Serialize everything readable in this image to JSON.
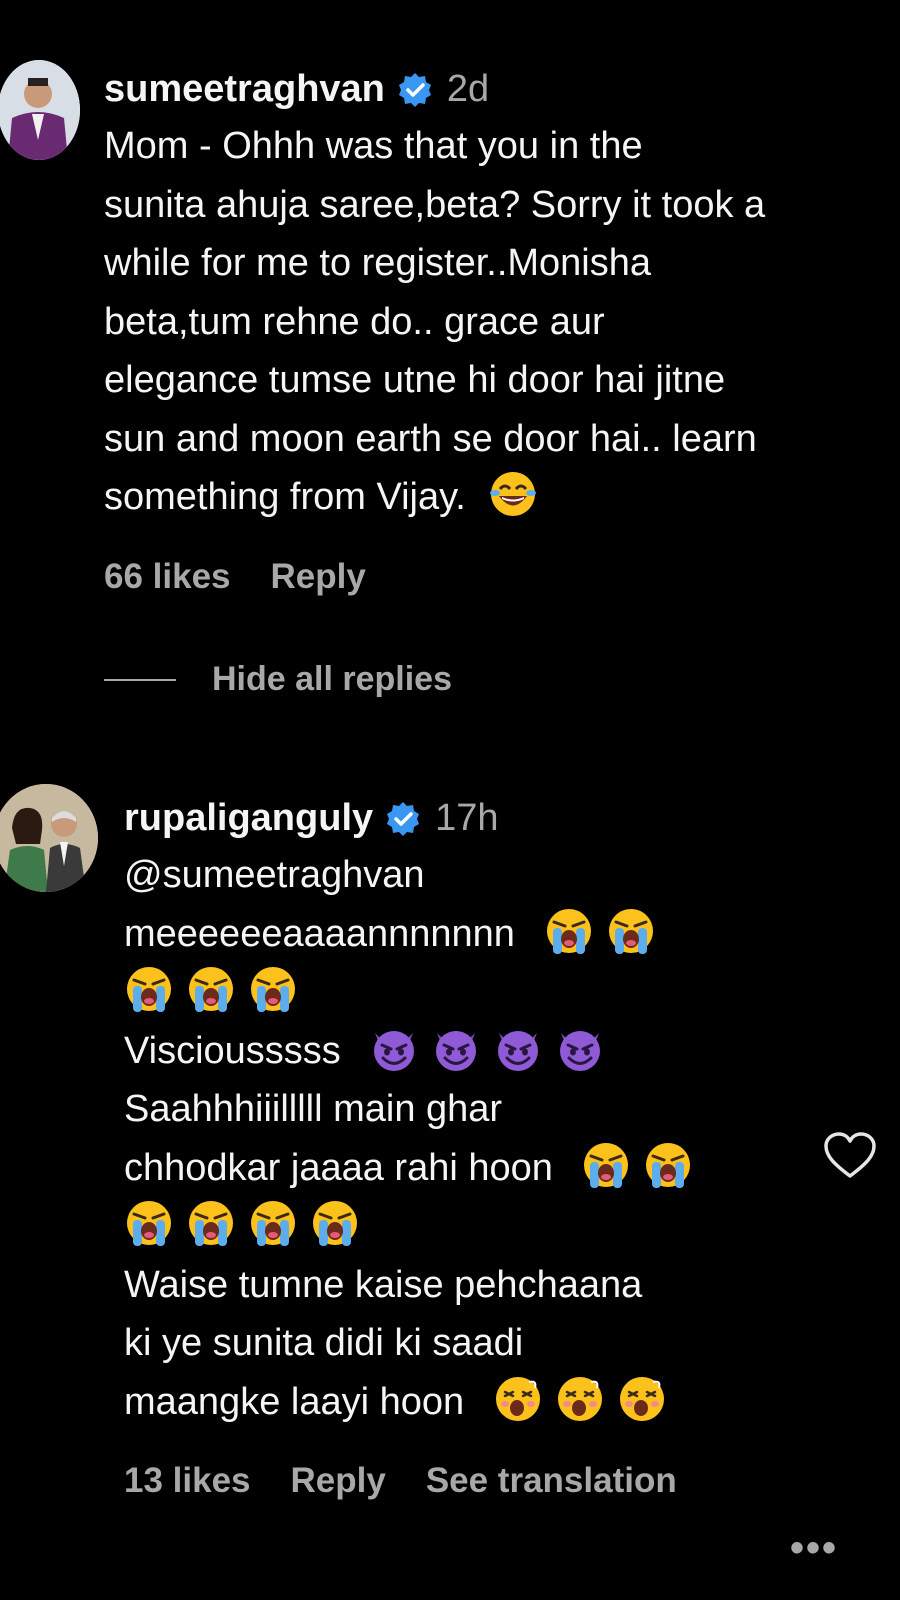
{
  "comments": [
    {
      "username": "sumeetraghvan",
      "time": "2d",
      "lines": [
        "Mom - Ohhh was that you in the",
        "sunita ahuja saree,beta? Sorry it took a",
        "while for me to register..Monisha",
        "beta,tum rehne do.. grace aur",
        "elegance tumse utne hi door hai jitne",
        "sun and moon earth se door hai.. learn",
        "something from Vijay."
      ],
      "likes": "66 likes",
      "reply": "Reply",
      "emojis": [
        "laughing-tears-emoji"
      ]
    },
    {
      "username": "rupaliganguly",
      "time": "17h",
      "lines": [
        "@sumeetraghvan",
        "meeeeeeaaaannnnnnn",
        "",
        "Visciousssss",
        "Saahhhiiilllll main ghar",
        "chhodkar jaaaa rahi hoon",
        "",
        "Waise tumne kaise pehchaana",
        "ki ye sunita didi ki saadi",
        "maangke laayi hoon"
      ],
      "likes": "13 likes",
      "reply": "Reply",
      "see_translation": "See translation"
    }
  ],
  "hide_replies": "Hide all replies",
  "icons": {
    "verified": "verified-badge-icon",
    "heart": "heart-outline-icon",
    "more": "more-options-icon"
  },
  "colors": {
    "background": "#000000",
    "text": "#f5f5f5",
    "muted": "#a8a8a8",
    "verified": "#3897f0"
  }
}
